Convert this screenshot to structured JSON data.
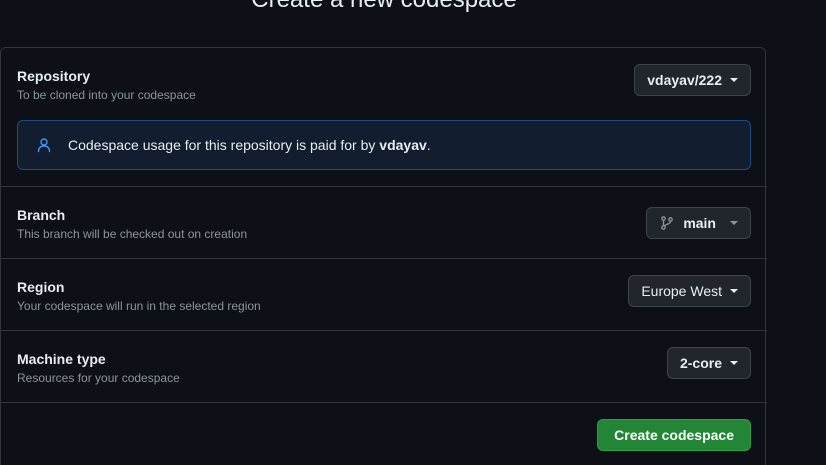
{
  "page": {
    "heading": "Create a new codespace"
  },
  "repository": {
    "title": "Repository",
    "subtitle": "To be cloned into your codespace",
    "selected": "vdayav/222",
    "notice_prefix": "Codespace usage for this repository is paid for by ",
    "notice_owner": "vdayav",
    "notice_suffix": "."
  },
  "branch": {
    "title": "Branch",
    "subtitle": "This branch will be checked out on creation",
    "selected": "main"
  },
  "region": {
    "title": "Region",
    "subtitle": "Your codespace will run in the selected region",
    "selected": "Europe West"
  },
  "machine": {
    "title": "Machine type",
    "subtitle": "Resources for your codespace",
    "selected": "2-core"
  },
  "actions": {
    "create_label": "Create codespace"
  },
  "icons": {
    "notice": "person-icon",
    "branch": "git-branch-icon"
  },
  "colors": {
    "primary": "#238636",
    "notice_border": "#1f4d80",
    "accent_icon": "#4493f8"
  }
}
